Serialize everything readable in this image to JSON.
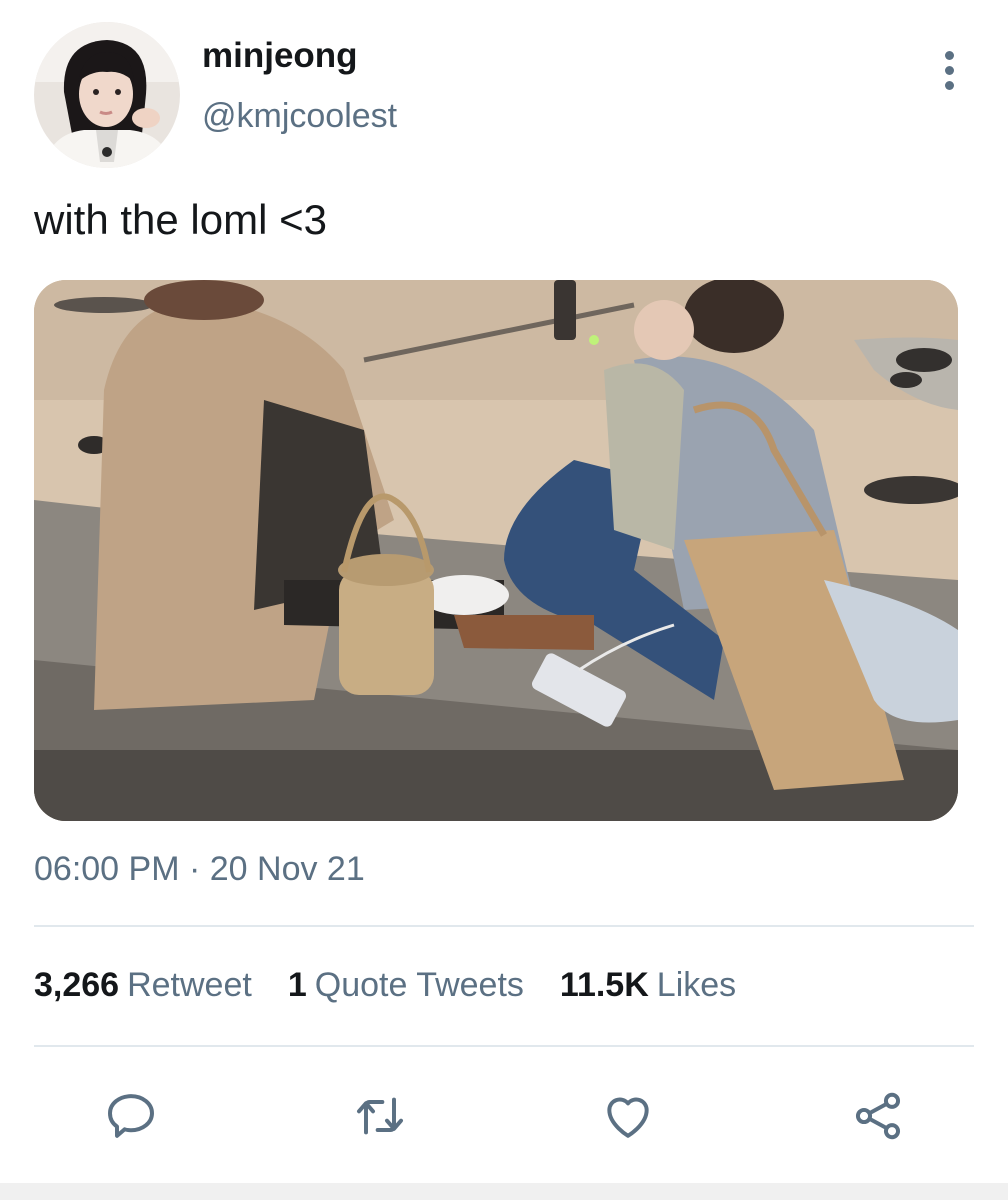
{
  "user": {
    "display_name": "minjeong",
    "handle": "@kmjcoolest"
  },
  "tweet": {
    "text": "with the loml <3",
    "timestamp": "06:00 PM · 20 Nov 21"
  },
  "stats": {
    "retweets": {
      "count": "3,266",
      "label": "Retweet"
    },
    "quotes": {
      "count": "1",
      "label": "Quote Tweets"
    },
    "likes": {
      "count": "11.5K",
      "label": "Likes"
    }
  },
  "icons": {
    "more": "more-vertical-icon",
    "reply": "reply-icon",
    "retweet": "retweet-icon",
    "like": "heart-icon",
    "share": "share-icon"
  },
  "colors": {
    "text_primary": "#14171a",
    "text_secondary": "#5b7083",
    "divider": "#e1e8ed"
  }
}
